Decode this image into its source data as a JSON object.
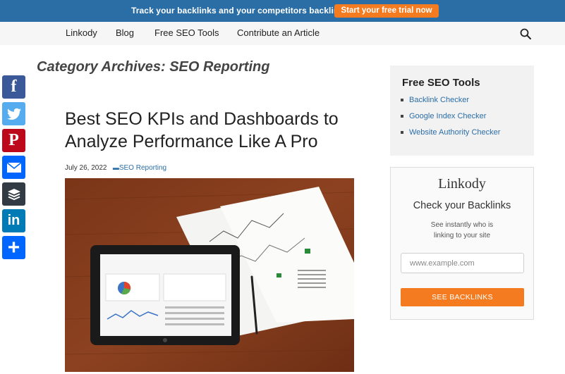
{
  "promo": {
    "text": "Track your backlinks and your competitors backlinks",
    "button": "Start your free trial now"
  },
  "nav": {
    "items": [
      "Linkody",
      "Blog",
      "Free SEO Tools",
      "Contribute an Article"
    ],
    "search_icon": "search-icon"
  },
  "archive": {
    "title": "Category Archives: SEO Reporting"
  },
  "post": {
    "title": "Best SEO KPIs and Dashboards to Analyze Performance Like A Pro",
    "date": "July 26, 2022",
    "category": "SEO Reporting"
  },
  "share": {
    "items": [
      {
        "name": "facebook",
        "glyph": "f",
        "color": "#3b5998"
      },
      {
        "name": "twitter",
        "glyph": "t",
        "color": "#55acee"
      },
      {
        "name": "pinterest",
        "glyph": "P",
        "color": "#bd081c"
      },
      {
        "name": "email",
        "glyph": "✉",
        "color": "#0166ff"
      },
      {
        "name": "buffer",
        "glyph": "≡",
        "color": "#323b43"
      },
      {
        "name": "linkedin",
        "glyph": "in",
        "color": "#007bb5"
      },
      {
        "name": "more",
        "glyph": "+",
        "color": "#0166ff"
      }
    ]
  },
  "sidebar": {
    "tools": {
      "title": "Free SEO Tools",
      "links": [
        "Backlink Checker",
        "Google Index Checker",
        "Website Authority Checker"
      ]
    },
    "checker": {
      "logo": "Linkody",
      "heading": "Check your Backlinks",
      "subtext_line1": "See instantly who is",
      "subtext_line2": "linking to your site",
      "input_placeholder": "www.example.com",
      "button": "SEE BACKLINKS"
    }
  },
  "colors": {
    "brand_blue": "#2b6ea6",
    "accent_orange": "#f47b20"
  }
}
